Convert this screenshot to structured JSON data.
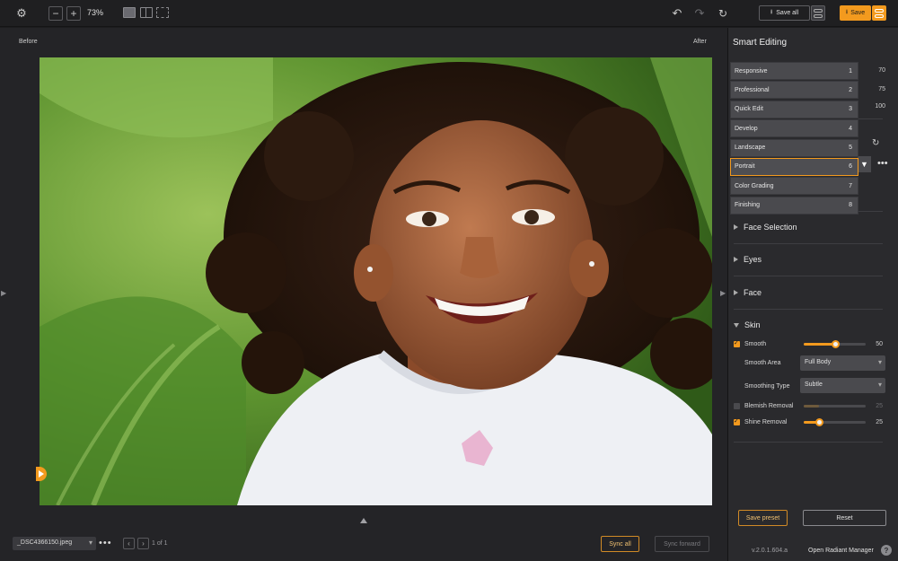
{
  "toolbar": {
    "zoom_minus": "−",
    "zoom_plus": "+",
    "zoom_level": "73%",
    "save_all_label": "Save all",
    "save_label": "Save",
    "accent": "#f39a1e"
  },
  "viewer": {
    "before_label": "Before",
    "after_label": "After"
  },
  "bottom": {
    "file_name": "_DSC4366150.jpeg",
    "more": "•••",
    "prev": "‹",
    "next": "›",
    "page_info": "1 of 1",
    "sync_all_label": "Sync all",
    "sync_forward_label": "Sync forward"
  },
  "panel": {
    "title": "Smart Editing",
    "background_values": [
      "70",
      "75",
      "100"
    ],
    "presets": [
      {
        "label": "Responsive",
        "num": "1"
      },
      {
        "label": "Professional",
        "num": "2"
      },
      {
        "label": "Quick Edit",
        "num": "3"
      },
      {
        "label": "Develop",
        "num": "4"
      },
      {
        "label": "Landscape",
        "num": "5"
      },
      {
        "label": "Portrait",
        "num": "6"
      },
      {
        "label": "Color Grading",
        "num": "7"
      },
      {
        "label": "Finishing",
        "num": "8"
      }
    ],
    "selected_preset": "Portrait",
    "more": "•••",
    "sections": {
      "face_selection": "Face Selection",
      "eyes": "Eyes",
      "face": "Face",
      "skin": "Skin"
    },
    "skin": {
      "smooth_label": "Smooth",
      "smooth_value": "50",
      "smooth_level": 0.5,
      "smooth_area_label": "Smooth Area",
      "smooth_area_value": "Full Body",
      "smoothing_type_label": "Smoothing Type",
      "smoothing_type_value": "Subtle",
      "blemish_label": "Blemish Removal",
      "blemish_value": "25",
      "blemish_level": 0.25,
      "shine_label": "Shine Removal",
      "shine_value": "25",
      "shine_level": 0.25
    },
    "save_preset_label": "Save preset",
    "reset_label": "Reset",
    "version": "v.2.0.1.604.a",
    "manager_label": "Open Radiant Manager",
    "help": "?"
  }
}
